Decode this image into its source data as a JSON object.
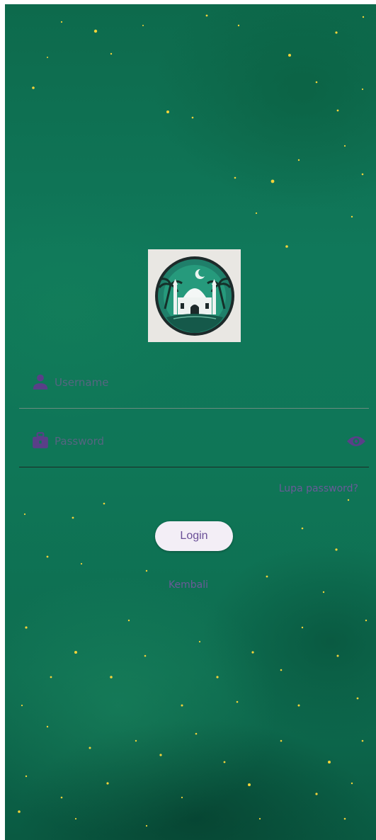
{
  "login_form": {
    "username_placeholder": "Username",
    "password_placeholder": "Password",
    "forgot_password_label": "Lupa password?",
    "login_button_label": "Login",
    "back_label": "Kembali"
  },
  "colors": {
    "background": "#0f7657",
    "star": "#f2d33a",
    "icon": "#5a3f88",
    "button_bg": "#f3eef6",
    "link": "#6a5a98"
  },
  "icons": {
    "username": "person-icon",
    "password": "briefcase-lock-icon",
    "visibility": "eye-icon",
    "logo": "mosque-logo-icon"
  }
}
